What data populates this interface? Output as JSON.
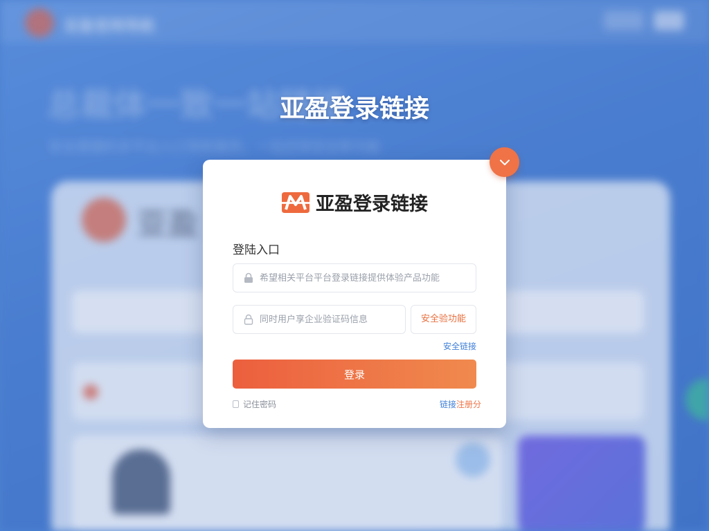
{
  "background": {
    "site_name": "亚盈官网导航",
    "hero_title": "总裁体一致一站链接",
    "hero_subtitle": "安全便捷的多平台入口导航服务，一站式体验全新功能",
    "panel_title": "亚盈"
  },
  "page_title": "亚盈登录链接",
  "modal": {
    "brand_name": "亚盈登录链接",
    "section_label": "登陆入口",
    "account_field": {
      "placeholder": "希望相关平台平台登录链接提供体验产品功能",
      "icon": "lock-icon"
    },
    "code_field": {
      "placeholder": "同时用户享企业验证码信息",
      "icon": "lock-icon"
    },
    "code_button_label": "安全验功能",
    "safe_link_label": "安全链接",
    "login_button_label": "登录",
    "remember_label": "记住密码",
    "register_link": {
      "main": "链接",
      "accent": "注册分"
    }
  },
  "colors": {
    "accent": "#ef7346",
    "link": "#3f7fd8",
    "background": "#4f86d6"
  }
}
